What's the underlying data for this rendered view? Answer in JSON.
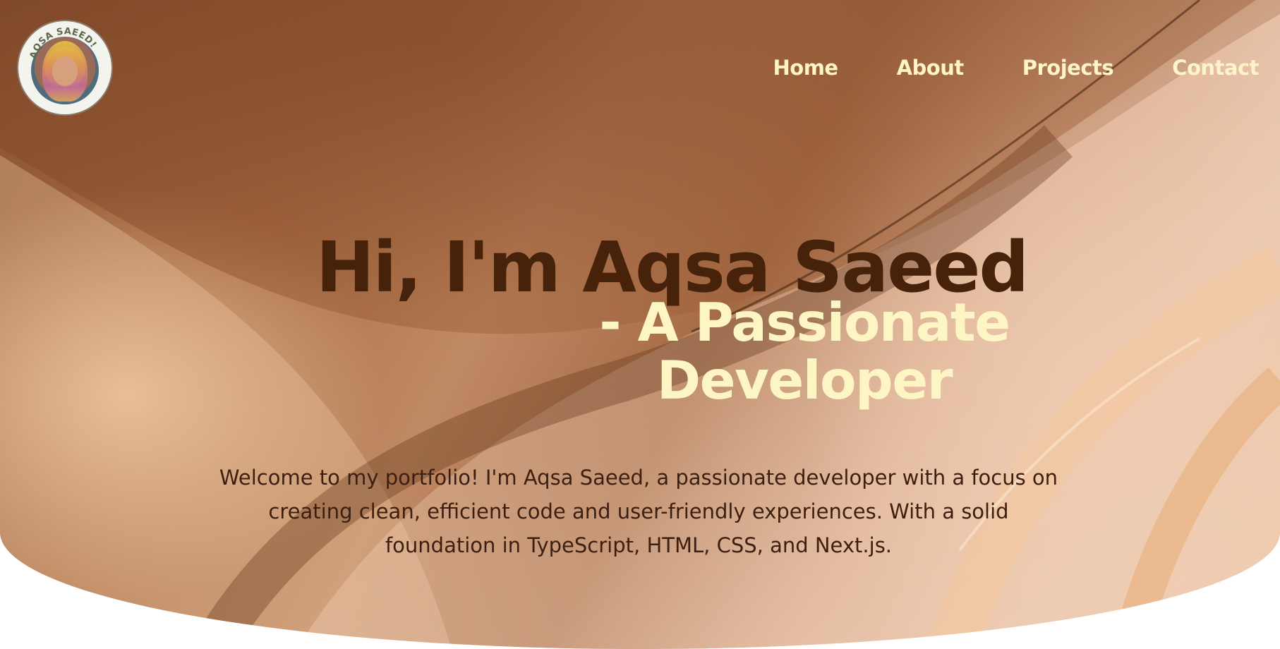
{
  "logo": {
    "arc_text": "AQSA SAEED!",
    "alt": "Profile photo of Aqsa Saeed"
  },
  "nav": {
    "items": [
      "Home",
      "About",
      "Projects",
      "Contact"
    ]
  },
  "hero": {
    "headline": "Hi, I'm Aqsa Saeed",
    "subline_1": "- A Passionate",
    "subline_2": "Developer",
    "intro": "Welcome to my portfolio! I'm Aqsa Saeed, a passionate developer with a focus on creating clean, efficient code and user-friendly experiences. With a solid foundation in TypeScript, HTML, CSS, and Next.js."
  },
  "colors": {
    "headline": "#452209",
    "accent_text": "#fdf6c4",
    "nav_text": "#fdf4c8",
    "body_text": "#3d1f10"
  }
}
